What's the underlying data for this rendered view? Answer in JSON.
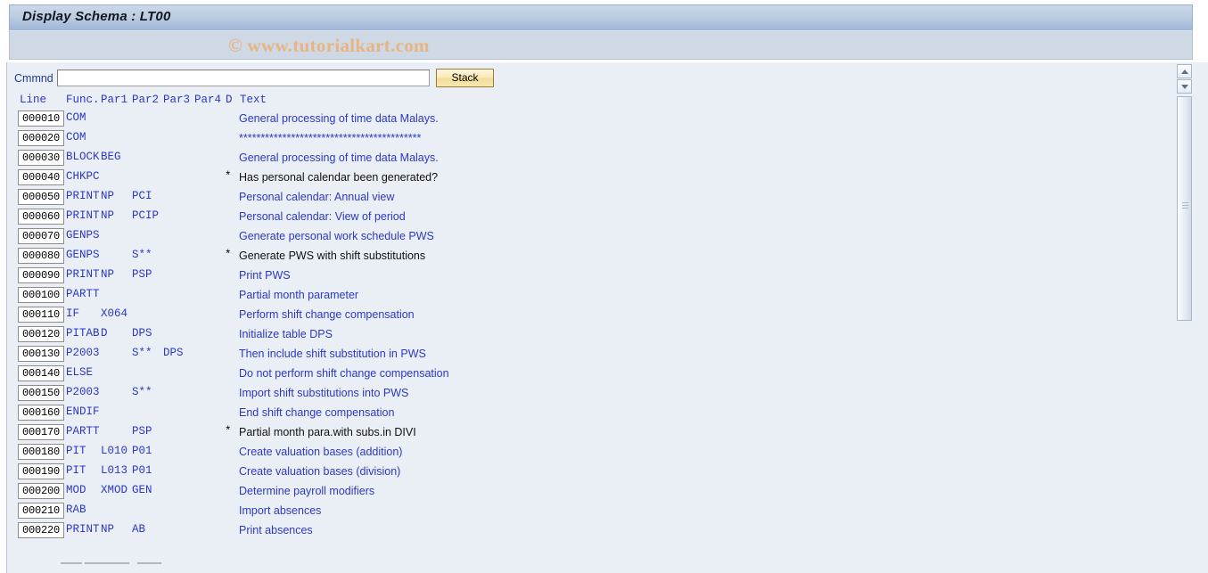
{
  "window": {
    "title": "Display Schema : LT00",
    "watermark": "© www.tutorialkart.com"
  },
  "toolbar": {
    "command_label": "Cmmnd",
    "command_value": "",
    "command_placeholder": "",
    "stack_label": "Stack"
  },
  "table": {
    "headers": {
      "line": "Line",
      "func": "Func.",
      "par1": "Par1",
      "par2": "Par2",
      "par3": "Par3",
      "par4": "Par4",
      "d": "D",
      "text": "Text"
    },
    "rows": [
      {
        "line": "000010",
        "func": "COM",
        "par1": "",
        "par2": "",
        "par3": "",
        "par4": "",
        "d": "",
        "text": "General processing of time data Malays.",
        "text_dark": false
      },
      {
        "line": "000020",
        "func": "COM",
        "par1": "",
        "par2": "",
        "par3": "",
        "par4": "",
        "d": "",
        "text": "******************************************",
        "text_dark": false
      },
      {
        "line": "000030",
        "func": "BLOCK",
        "par1": "BEG",
        "par2": "",
        "par3": "",
        "par4": "",
        "d": "",
        "text": "General processing of time data Malays.",
        "text_dark": false
      },
      {
        "line": "000040",
        "func": "CHKPC",
        "par1": "",
        "par2": "",
        "par3": "",
        "par4": "",
        "d": "*",
        "text": "Has personal calendar been generated?",
        "text_dark": true
      },
      {
        "line": "000050",
        "func": "PRINT",
        "par1": "NP",
        "par2": "PCI",
        "par3": "",
        "par4": "",
        "d": "",
        "text": "Personal calendar: Annual view",
        "text_dark": false
      },
      {
        "line": "000060",
        "func": "PRINT",
        "par1": "NP",
        "par2": "PCIP",
        "par3": "",
        "par4": "",
        "d": "",
        "text": "Personal calendar: View of period",
        "text_dark": false
      },
      {
        "line": "000070",
        "func": "GENPS",
        "par1": "",
        "par2": "",
        "par3": "",
        "par4": "",
        "d": "",
        "text": "Generate personal work schedule PWS",
        "text_dark": false
      },
      {
        "line": "000080",
        "func": "GENPS",
        "par1": "",
        "par2": "S**",
        "par3": "",
        "par4": "",
        "d": "*",
        "text": "Generate PWS with shift substitutions",
        "text_dark": true
      },
      {
        "line": "000090",
        "func": "PRINT",
        "par1": "NP",
        "par2": "PSP",
        "par3": "",
        "par4": "",
        "d": "",
        "text": "Print PWS",
        "text_dark": false
      },
      {
        "line": "000100",
        "func": "PARTT",
        "par1": "",
        "par2": "",
        "par3": "",
        "par4": "",
        "d": "",
        "text": "Partial month parameter",
        "text_dark": false
      },
      {
        "line": "000110",
        "func": "IF",
        "par1": "X064",
        "par2": "",
        "par3": "",
        "par4": "",
        "d": "",
        "text": "Perform shift change compensation",
        "text_dark": false
      },
      {
        "line": "000120",
        "func": "PITAB",
        "par1": "D",
        "par2": "DPS",
        "par3": "",
        "par4": "",
        "d": "",
        "text": "Initialize table DPS",
        "text_dark": false
      },
      {
        "line": "000130",
        "func": "P2003",
        "par1": "",
        "par2": "S**",
        "par3": "DPS",
        "par4": "",
        "d": "",
        "text": "Then include shift substitution in PWS",
        "text_dark": false
      },
      {
        "line": "000140",
        "func": "ELSE",
        "par1": "",
        "par2": "",
        "par3": "",
        "par4": "",
        "d": "",
        "text": "Do not perform shift change compensation",
        "text_dark": false
      },
      {
        "line": "000150",
        "func": "P2003",
        "par1": "",
        "par2": "S**",
        "par3": "",
        "par4": "",
        "d": "",
        "text": "Import shift substitutions into PWS",
        "text_dark": false
      },
      {
        "line": "000160",
        "func": "ENDIF",
        "par1": "",
        "par2": "",
        "par3": "",
        "par4": "",
        "d": "",
        "text": "End shift change compensation",
        "text_dark": false
      },
      {
        "line": "000170",
        "func": "PARTT",
        "par1": "",
        "par2": "PSP",
        "par3": "",
        "par4": "",
        "d": "*",
        "text": "Partial month para.with subs.in DIVI",
        "text_dark": true
      },
      {
        "line": "000180",
        "func": "PIT",
        "par1": "L010",
        "par2": "P01",
        "par3": "",
        "par4": "",
        "d": "",
        "text": "Create valuation bases (addition)",
        "text_dark": false
      },
      {
        "line": "000190",
        "func": "PIT",
        "par1": "L013",
        "par2": "P01",
        "par3": "",
        "par4": "",
        "d": "",
        "text": "Create valuation bases (division)",
        "text_dark": false
      },
      {
        "line": "000200",
        "func": "MOD",
        "par1": "XMOD",
        "par2": "GEN",
        "par3": "",
        "par4": "",
        "d": "",
        "text": "Determine payroll modifiers",
        "text_dark": false
      },
      {
        "line": "000210",
        "func": "RAB",
        "par1": "",
        "par2": "",
        "par3": "",
        "par4": "",
        "d": "",
        "text": "Import absences",
        "text_dark": false
      },
      {
        "line": "000220",
        "func": "PRINT",
        "par1": "NP",
        "par2": "AB",
        "par3": "",
        "par4": "",
        "d": "",
        "text": "Print absences",
        "text_dark": false
      }
    ]
  },
  "scrollbars": {
    "vertical_up_icon": "scroll-up-arrow",
    "vertical_down_icon": "scroll-down-arrow"
  },
  "colors": {
    "title_bar": "#a5bcd8",
    "sub_band": "#ced9e5",
    "content_bg": "#eaeff5",
    "link_blue": "#2b38c4",
    "label_blue": "#1f3a93",
    "watermark": "#e9b483",
    "stack_button_border": "#9c7b2e"
  }
}
